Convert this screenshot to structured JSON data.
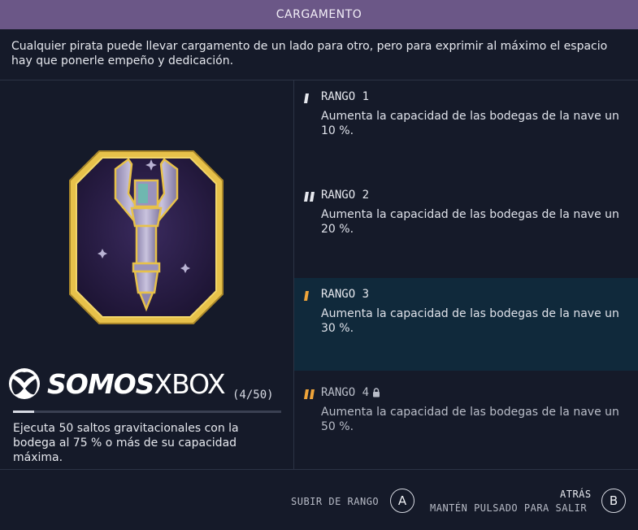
{
  "header": {
    "title": "CARGAMENTO"
  },
  "description": "Cualquier pirata puede llevar cargamento de un lado para otro, pero para exprimir al máximo el espacio hay que ponerle empeño y dedicación.",
  "watermark": {
    "brand_bold": "SOMOS",
    "brand_light": "XBOX"
  },
  "challenge": {
    "progress_label": "(4/50)",
    "progress_fraction": 0.08,
    "text": "Ejecuta 50 saltos gravitacionales con la bodega al 75 % o más de su capacidad máxima."
  },
  "ranks": [
    {
      "title": "RANGO 1",
      "description": "Aumenta la capacidad de las bodegas de la nave un 10 %.",
      "state": "unlocked"
    },
    {
      "title": "RANGO 2",
      "description": "Aumenta la capacidad de las bodegas de la nave un 20 %.",
      "state": "unlocked"
    },
    {
      "title": "RANGO 3",
      "description": "Aumenta la capacidad de las bodegas de la nave un 30 %.",
      "state": "selected"
    },
    {
      "title": "RANGO 4",
      "description": "Aumenta la capacidad de las bodegas de la nave un 50 %.",
      "state": "locked"
    }
  ],
  "footer": {
    "rank_up_label": "SUBIR DE RANGO",
    "rank_up_button": "A",
    "back_label": "ATRÁS",
    "back_hint": "MANTÉN PULSADO PARA SALIR",
    "back_button": "B"
  },
  "colors": {
    "header_bg": "#6b5787",
    "background": "#151a29",
    "selected_bg": "#10293b",
    "accent_orange": "#f0a53a",
    "rank_mark_white": "#e6e8ee",
    "badge_gold": "#e7c14a",
    "badge_purple": "#2a1d47"
  }
}
